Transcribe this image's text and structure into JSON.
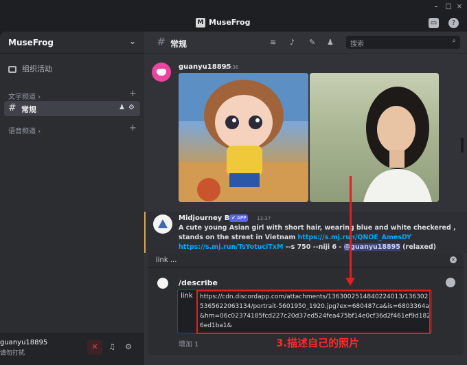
{
  "window": {
    "title": "MuseFrog",
    "logo_letter": "M",
    "controls": [
      "–",
      "□",
      "×"
    ]
  },
  "sidebar": {
    "server_name": "MuseFrog",
    "event_label": "组织活动",
    "text_category": "文字频道",
    "active_channel": "常规",
    "voice_category": "语音频道"
  },
  "user": {
    "name": "guanyu18895",
    "status": "请勿打扰",
    "controls": [
      "mute-icon",
      "headphones-icon",
      "gear-icon"
    ]
  },
  "header": {
    "channel": "常规",
    "search_placeholder": "搜索",
    "icons": [
      "threads-icon",
      "bell-icon",
      "pin-icon",
      "members-icon"
    ]
  },
  "message1": {
    "user": "guanyu18895",
    "time": "13:36"
  },
  "bot_message": {
    "name": "Midjourney Bot",
    "badge": "✔ APP",
    "time": "13:37",
    "line1": "A cute young Asian girl with short hair, wearing blue and white checkered ,",
    "line2_text": "stands on the street in Vietnam ",
    "line2_link": "https://s.mj.run/QNOE_AmesDY",
    "line3_link": "https://s.mj.run/TsYotuciTxM",
    "line3_text": " --s 750 --niji 6 - ",
    "line3_mention": "@guanyu18895",
    "line3_suffix": " (relaxed)"
  },
  "popup": {
    "title": "link ...",
    "command": "/describe",
    "option_label": "link",
    "url_value": "https://cdn.discordapp.com/attachments/1363002514840224013/1363025365622063134/portrait-5601950_1920.jpg?ex=680487ca&is=6803364a&hm=06c02374185fcd227c20d37ed524fea475bf14e0cf36d2f461ef9d1826ed1ba1&",
    "more": "增加 1"
  },
  "annotation": "3.描述自己的照片",
  "colors": {
    "accent": "#5865f2",
    "annotation_red": "#e02020",
    "link": "#00a8fc"
  }
}
